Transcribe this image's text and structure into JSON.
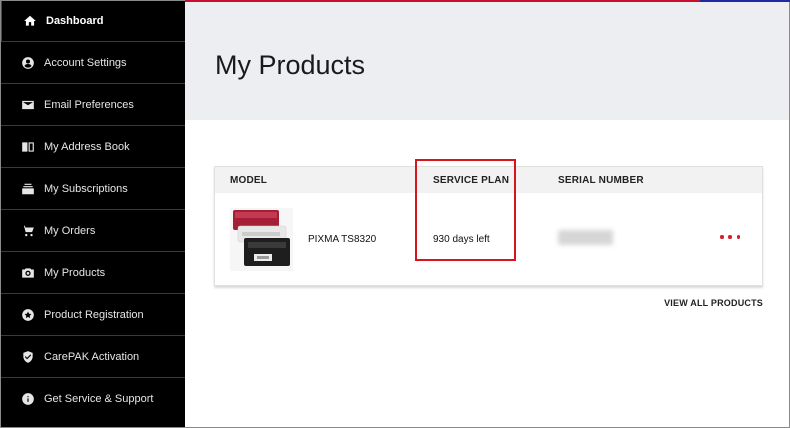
{
  "sidebar": {
    "items": [
      {
        "label": "Dashboard",
        "icon": "home-icon"
      },
      {
        "label": "Account Settings",
        "icon": "user-icon"
      },
      {
        "label": "Email Preferences",
        "icon": "envelope-icon"
      },
      {
        "label": "My Address Book",
        "icon": "book-icon"
      },
      {
        "label": "My Subscriptions",
        "icon": "subscriptions-icon"
      },
      {
        "label": "My Orders",
        "icon": "cart-icon"
      },
      {
        "label": "My Products",
        "icon": "camera-icon"
      },
      {
        "label": "Product Registration",
        "icon": "registration-icon"
      },
      {
        "label": "CarePAK Activation",
        "icon": "shield-icon"
      },
      {
        "label": "Get Service & Support",
        "icon": "info-icon"
      }
    ],
    "active_index": 0
  },
  "main": {
    "title": "My Products",
    "table": {
      "columns": [
        "MODEL",
        "SERVICE PLAN",
        "SERIAL NUMBER"
      ],
      "rows": [
        {
          "model": "PIXMA TS8320",
          "service_plan": "930 days left",
          "serial_number": "",
          "image": "printer-image"
        }
      ]
    },
    "view_all_label": "VIEW ALL PRODUCTS"
  },
  "colors": {
    "accent": "#d4202a",
    "sidebar_bg": "#000000",
    "hero_bg": "#eceef1",
    "highlight": "#d9141e"
  }
}
